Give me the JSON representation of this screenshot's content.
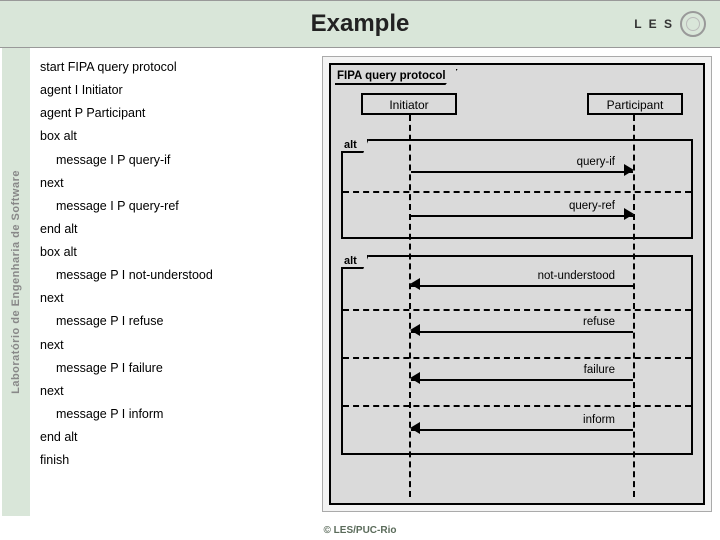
{
  "header": {
    "title": "Example"
  },
  "logo": {
    "text": "L E S"
  },
  "sidebar": {
    "text": "Laboratório de Engenharia de Software"
  },
  "code": {
    "lines": [
      {
        "text": "start FIPA query protocol",
        "indent": 0
      },
      {
        "text": "agent I Initiator",
        "indent": 0
      },
      {
        "text": "agent P Participant",
        "indent": 0
      },
      {
        "text": "box alt",
        "indent": 0
      },
      {
        "text": "message I P query-if",
        "indent": 1
      },
      {
        "text": "next",
        "indent": 0
      },
      {
        "text": "message I P query-ref",
        "indent": 1
      },
      {
        "text": "end alt",
        "indent": 0
      },
      {
        "text": "box alt",
        "indent": 0
      },
      {
        "text": "message P I not-understood",
        "indent": 1
      },
      {
        "text": "next",
        "indent": 0
      },
      {
        "text": "message P I refuse",
        "indent": 1
      },
      {
        "text": "next",
        "indent": 0
      },
      {
        "text": "message P I failure",
        "indent": 1
      },
      {
        "text": "next",
        "indent": 0
      },
      {
        "text": "message P I inform",
        "indent": 1
      },
      {
        "text": "end alt",
        "indent": 0
      },
      {
        "text": "finish",
        "indent": 0
      }
    ]
  },
  "diagram": {
    "title": "FIPA query protocol",
    "lifelines": {
      "initiator": "Initiator",
      "participant": "Participant"
    },
    "alt_label": "alt",
    "alt1": {
      "messages": [
        {
          "label": "query-if",
          "dir": "r"
        },
        {
          "label": "query-ref",
          "dir": "r"
        }
      ]
    },
    "alt2": {
      "messages": [
        {
          "label": "not-understood",
          "dir": "l"
        },
        {
          "label": "refuse",
          "dir": "l"
        },
        {
          "label": "failure",
          "dir": "l"
        },
        {
          "label": "inform",
          "dir": "l"
        }
      ]
    }
  },
  "footer": {
    "text": "© LES/PUC-Rio"
  }
}
